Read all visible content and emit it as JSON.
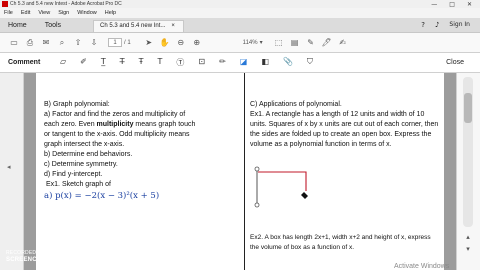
{
  "window": {
    "title": "Ch 5.3 and 5.4 new Intest - Adobe Acrobat Pro DC",
    "controls": [
      "—",
      "□",
      "✕"
    ]
  },
  "menu": [
    "File",
    "Edit",
    "View",
    "Sign",
    "Window",
    "Help"
  ],
  "tabs": {
    "home": "Home",
    "tools": "Tools",
    "document": "Ch 5.3 and 5.4 new Int...",
    "document_close": "×",
    "sign_in": "Sign In"
  },
  "toolbar": {
    "page_current": "1",
    "page_total": "/ 1",
    "zoom": "114%"
  },
  "comment_bar": {
    "label": "Comment",
    "close": "Close"
  },
  "document": {
    "left": {
      "heading": "B) Graph polynomial:",
      "line_a1": "a) Factor and find the zeros and multiplicity of",
      "line_a2_pre": "each zero.  Even ",
      "line_a2_bold": "multiplicity",
      "line_a2_post": " means graph touch",
      "line_a3": "or tangent to the x-axis. Odd multiplicity means",
      "line_a4": "graph intersect the x-axis.",
      "line_b": "b) Determine end behaviors.",
      "line_c": "c) Determine symmetry.",
      "line_d": "d) Find y-intercept.",
      "ex1": "Ex1.  Sketch graph of",
      "equation": "a)  p(x) = −2(x − 3)²(x + 5)"
    },
    "right": {
      "heading": "C) Applications of polynomial.",
      "ex1": "Ex1. A rectangle has a length of 12 units and width of 10 units. Squares of x by x units are cut out of each corner, then the sides are folded up to create an open box. Express the volume as a polynomial function in terms of x.",
      "ex2": "Ex2. A box has length 2x+1, width x+2 and height of x, express the volume of box as a function of x."
    }
  },
  "overlays": {
    "recorded_with": "RECORDED WITH",
    "screencast": "SCREENCAST ◉ MATIC",
    "activate": "Activate Windows"
  },
  "colors": {
    "equation": "#1a3fa0",
    "sketch_line": "#c0182a"
  },
  "icons": [
    "save-icon",
    "print-icon",
    "mail-icon",
    "search-icon",
    "hand-icon",
    "up-icon",
    "down-icon",
    "sticky-note-icon",
    "highlight-icon",
    "underline-icon",
    "strikethrough-icon",
    "textbox-icon",
    "pencil-icon",
    "eraser-icon",
    "shapes-icon"
  ]
}
